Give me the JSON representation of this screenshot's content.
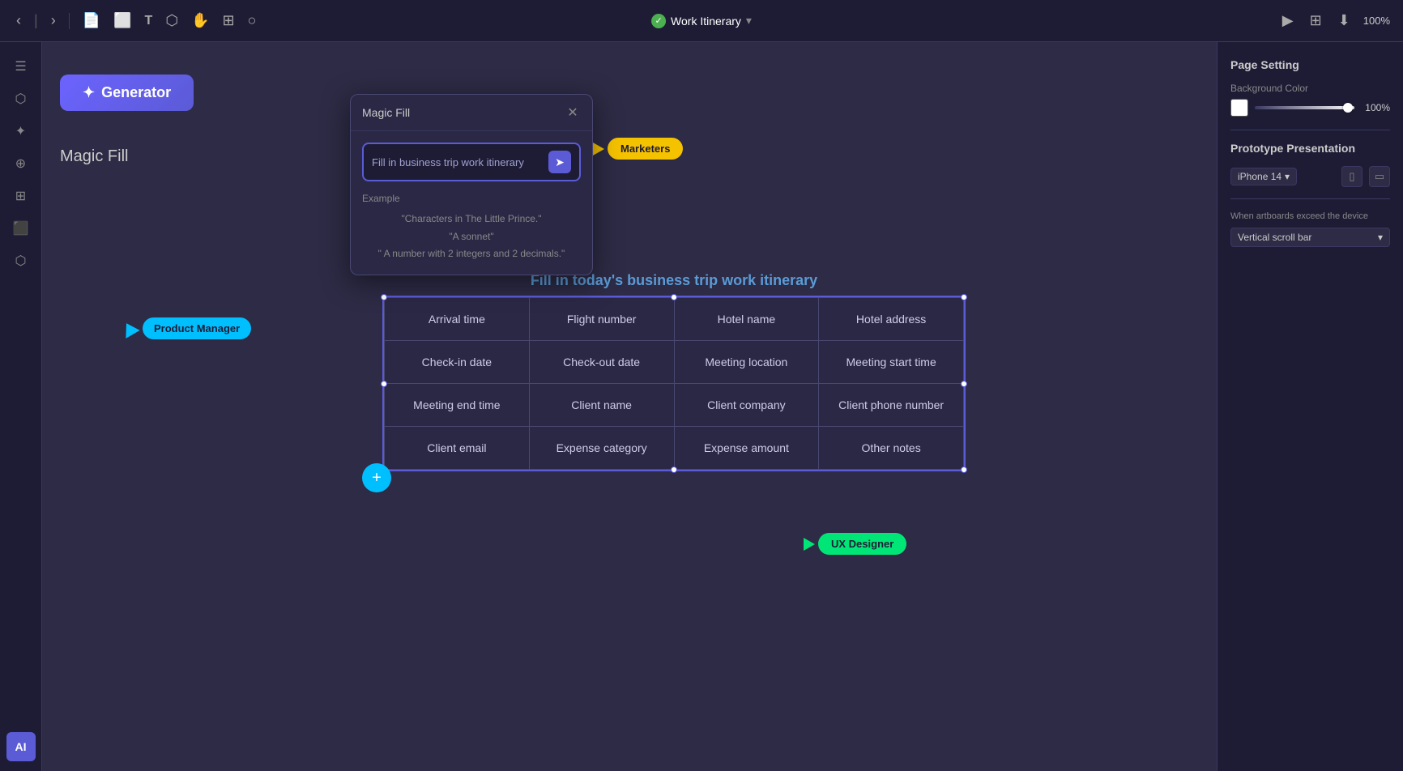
{
  "toolbar": {
    "title": "Work Itinerary",
    "chevron": "▾",
    "zoom": "100%",
    "back_icon": "‹",
    "pipe_icon": "|",
    "frame_icon": "⬜",
    "text_icon": "T",
    "shapes_icon": "⬡",
    "hand_icon": "✋",
    "component_icon": "⊞",
    "circle_icon": "○",
    "play_icon": "▶",
    "grid_icon": "⊞",
    "download_icon": "⬇"
  },
  "sidebar": {
    "icons": [
      "☰",
      "⬡",
      "✦",
      "⊕",
      "⊞",
      "⬛",
      "⬡"
    ],
    "ai_label": "AI"
  },
  "right_panel": {
    "page_setting_label": "Page Setting",
    "bg_color_label": "Background Color",
    "bg_opacity": "100%",
    "prototype_label": "Prototype Presentation",
    "device_label": "iPhone 14",
    "exceed_label": "When artboards exceed the device",
    "scroll_label": "Vertical scroll bar"
  },
  "generator_button": {
    "label": "Generator",
    "sparkle": "✦"
  },
  "magic_fill_sidebar_label": "Magic Fill",
  "popup": {
    "title": "Magic Fill",
    "close": "✕",
    "prompt": "Fill in business trip work itinerary",
    "send_icon": "➤",
    "example_label": "Example",
    "examples": [
      "\"Characters in The Little Prince.\"",
      "\"A sonnet\"",
      "\" A number with 2 integers and 2 decimals.\""
    ]
  },
  "cursors": {
    "pm_label": "Product Manager",
    "marketers_label": "Marketers",
    "ux_label": "UX Designer"
  },
  "table": {
    "heading": "Fill in today's business trip work itinerary",
    "cells": [
      [
        "Arrival time",
        "Flight number",
        "Hotel name",
        "Hotel address"
      ],
      [
        "Check-in date",
        "Check-out date",
        "Meeting location",
        "Meeting start time"
      ],
      [
        "Meeting end time",
        "Client name",
        "Client company",
        "Client phone number"
      ],
      [
        "Client email",
        "Expense category",
        "Expense amount",
        "Other notes"
      ]
    ]
  },
  "add_row_icon": "+"
}
